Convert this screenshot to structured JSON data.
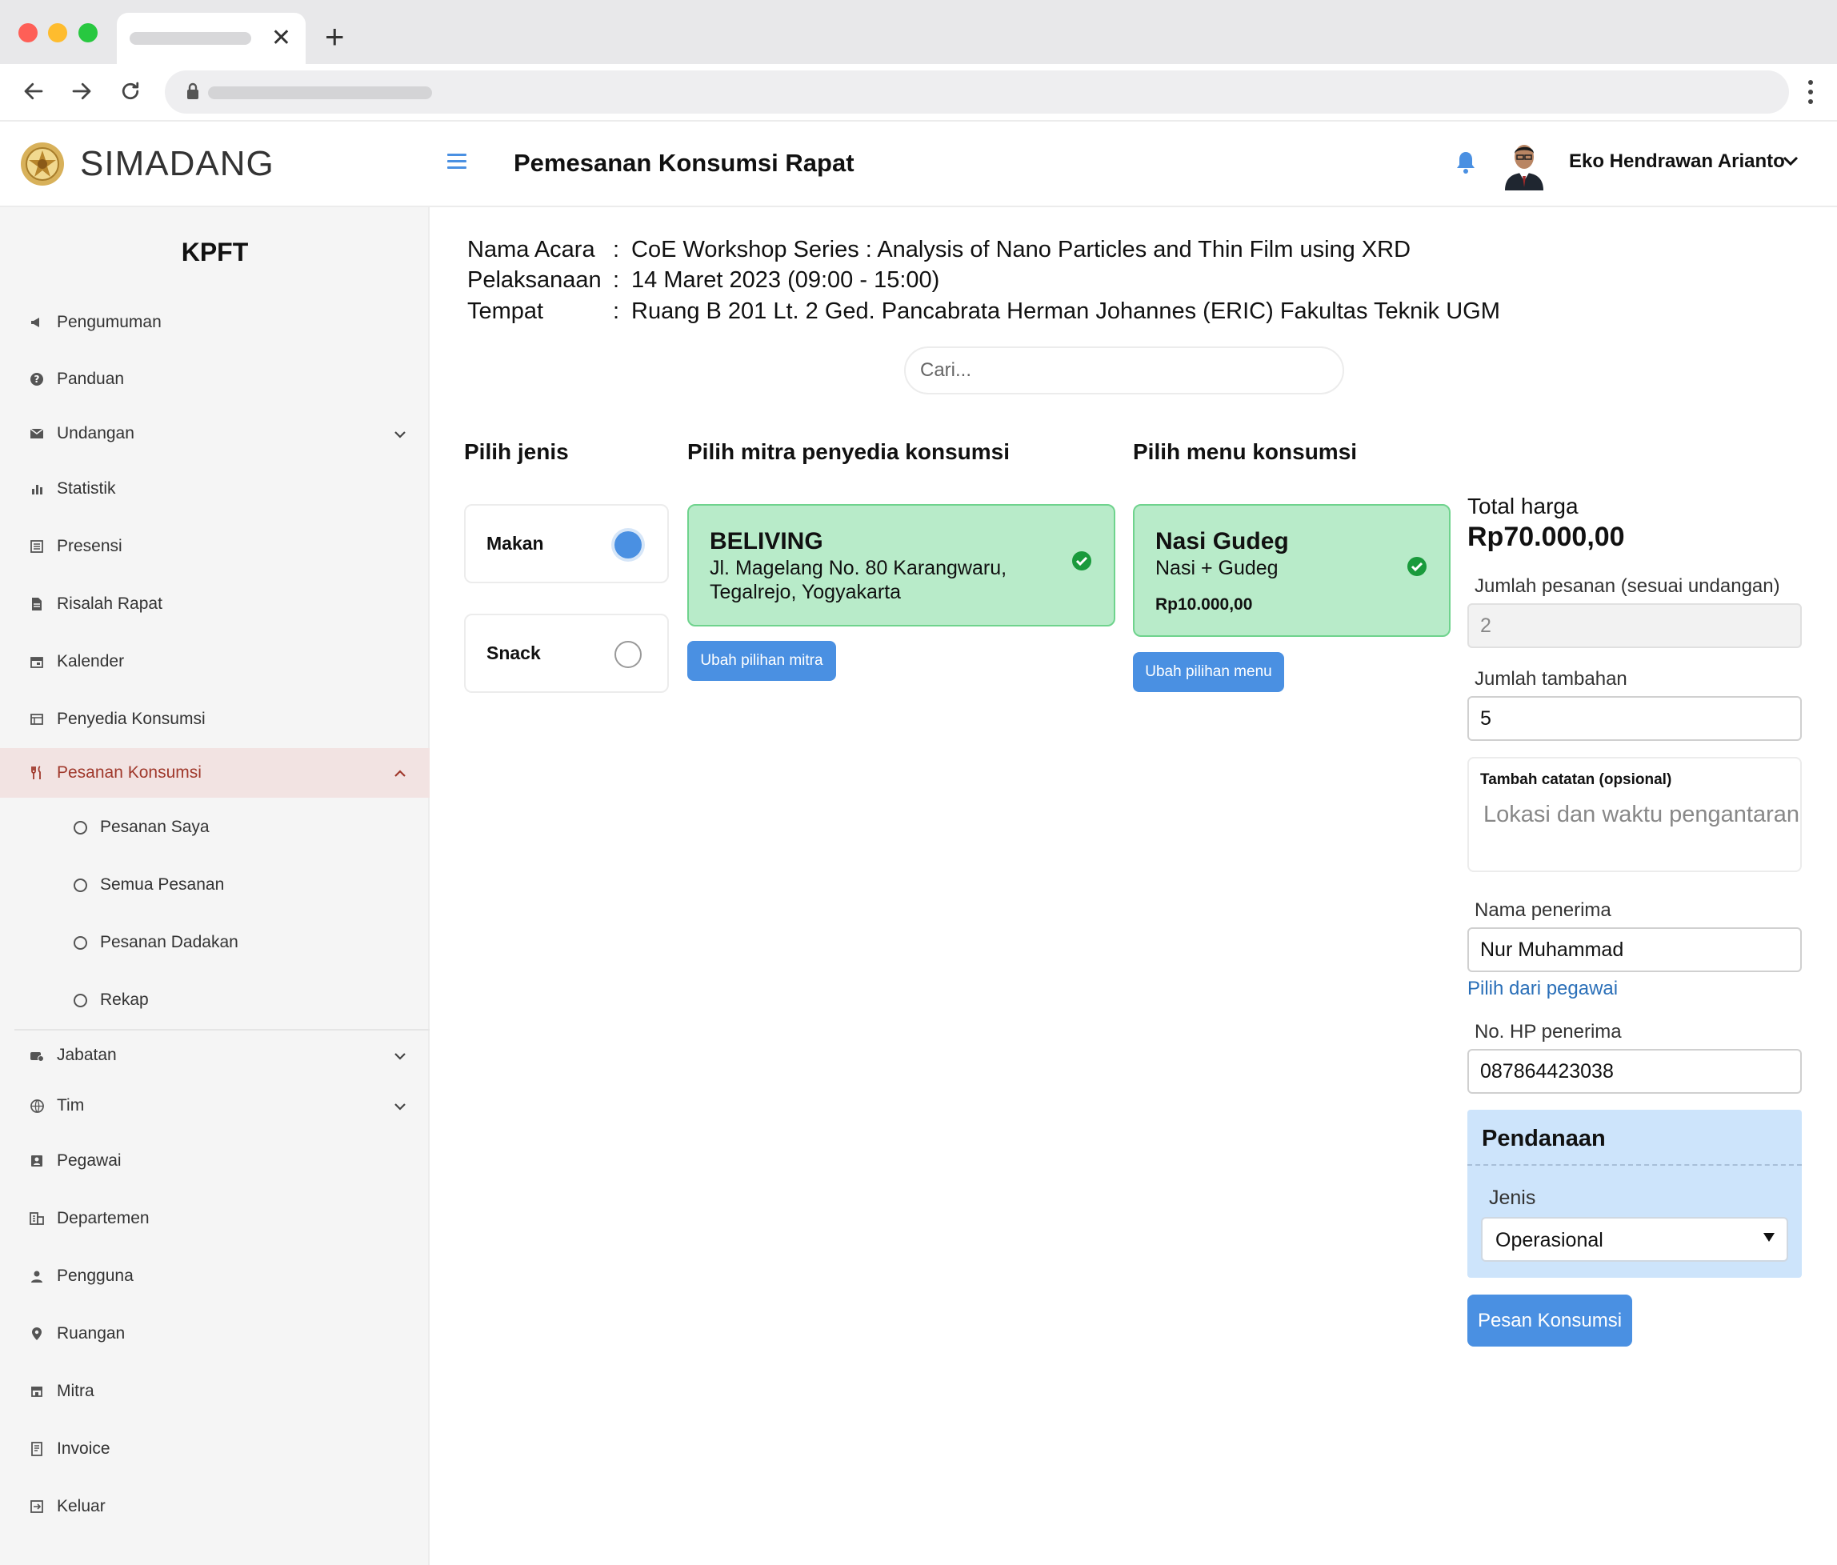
{
  "browser": {
    "icons": {
      "back": "arrow-left-icon",
      "forward": "arrow-right-icon",
      "reload": "reload-icon",
      "lock": "lock-icon",
      "menu": "kebab-menu-icon",
      "close": "close-icon",
      "new_tab": "plus-icon"
    },
    "new_tab_label": "+",
    "close_label": "✕"
  },
  "brand": {
    "name": "SIMADANG",
    "logo_icon": "seal-logo"
  },
  "sidebar": {
    "org": "KPFT",
    "items": [
      {
        "label": "Pengumuman",
        "icon": "megaphone-icon"
      },
      {
        "label": "Panduan",
        "icon": "help-circle-icon"
      },
      {
        "label": "Undangan",
        "icon": "envelope-icon",
        "chevron": "⌄"
      },
      {
        "label": "Statistik",
        "icon": "bar-chart-icon"
      },
      {
        "label": "Presensi",
        "icon": "list-icon"
      },
      {
        "label": "Risalah Rapat",
        "icon": "document-icon"
      },
      {
        "label": "Kalender",
        "icon": "calendar-icon"
      },
      {
        "label": "Penyedia Konsumsi",
        "icon": "store-icon"
      },
      {
        "label": "Pesanan Konsumsi",
        "icon": "utensils-icon",
        "chevron": "⌃",
        "active": true
      },
      {
        "label": "Jabatan",
        "icon": "briefcase-icon",
        "chevron": "⌄"
      },
      {
        "label": "Tim",
        "icon": "globe-icon",
        "chevron": "⌄"
      },
      {
        "label": "Pegawai",
        "icon": "id-card-icon"
      },
      {
        "label": "Departemen",
        "icon": "building-icon"
      },
      {
        "label": "Pengguna",
        "icon": "user-icon"
      },
      {
        "label": "Ruangan",
        "icon": "map-pin-icon"
      },
      {
        "label": "Mitra",
        "icon": "shop-icon"
      },
      {
        "label": "Invoice",
        "icon": "invoice-icon"
      },
      {
        "label": "Keluar",
        "icon": "logout-icon"
      }
    ],
    "sub_items": [
      {
        "label": "Pesanan Saya"
      },
      {
        "label": "Semua Pesanan"
      },
      {
        "label": "Pesanan Dadakan"
      },
      {
        "label": "Rekap"
      }
    ]
  },
  "header": {
    "title": "Pemesanan Konsumsi Rapat",
    "user_name": "Eko Hendrawan Arianto",
    "icons": {
      "menu": "hamburger-icon",
      "bell": "bell-icon",
      "avatar": "user-avatar",
      "chevron": "chevron-down-icon"
    }
  },
  "event": {
    "rows": [
      {
        "label": "Nama Acara",
        "colon": ":",
        "value": "CoE Workshop Series : Analysis of Nano Particles and Thin Film using XRD"
      },
      {
        "label": "Pelaksanaan",
        "colon": ":",
        "value": "14 Maret 2023 (09:00 - 15:00)"
      },
      {
        "label": "Tempat",
        "colon": ":",
        "value": "Ruang B 201 Lt. 2 Ged. Pancabrata Herman Johannes (ERIC) Fakultas Teknik UGM"
      }
    ]
  },
  "search": {
    "placeholder": "Cari..."
  },
  "columns": {
    "type": "Pilih jenis",
    "partner": "Pilih mitra penyedia konsumsi",
    "menu": "Pilih menu konsumsi"
  },
  "types": [
    {
      "label": "Makan",
      "selected": true
    },
    {
      "label": "Snack",
      "selected": false
    }
  ],
  "partner": {
    "name": "BELIVING",
    "address_line1": "Jl. Magelang No. 80 Karangwaru,",
    "address_line2": "Tegalrejo, Yogyakarta",
    "change_label": "Ubah pilihan mitra"
  },
  "menu": {
    "name": "Nasi Gudeg",
    "desc": "Nasi + Gudeg",
    "price": "Rp10.000,00",
    "change_label": "Ubah pilihan menu"
  },
  "order": {
    "total_label": "Total harga",
    "total_value": "Rp70.000,00",
    "qty_label": "Jumlah pesanan (sesuai undangan)",
    "qty_value": "2",
    "extra_label": "Jumlah tambahan",
    "extra_value": "5",
    "note_label": "Tambah catatan (opsional)",
    "note_placeholder": "Lokasi dan waktu pengantaran",
    "recipient_label": "Nama penerima",
    "recipient_value": "Nur Muhammad",
    "pick_employee": "Pilih dari pegawai",
    "phone_label": "No. HP penerima",
    "phone_value": "087864423038",
    "funding_title": "Pendanaan",
    "funding_type_label": "Jenis",
    "funding_type_value": "Operasional",
    "submit_label": "Pesan Konsumsi"
  },
  "colors": {
    "accent": "#4a90e2",
    "active_bg": "#f2e3e2",
    "active_text": "#a0392c",
    "selected_card": "#b8ebc9",
    "funding_bg": "#cde4fb"
  }
}
